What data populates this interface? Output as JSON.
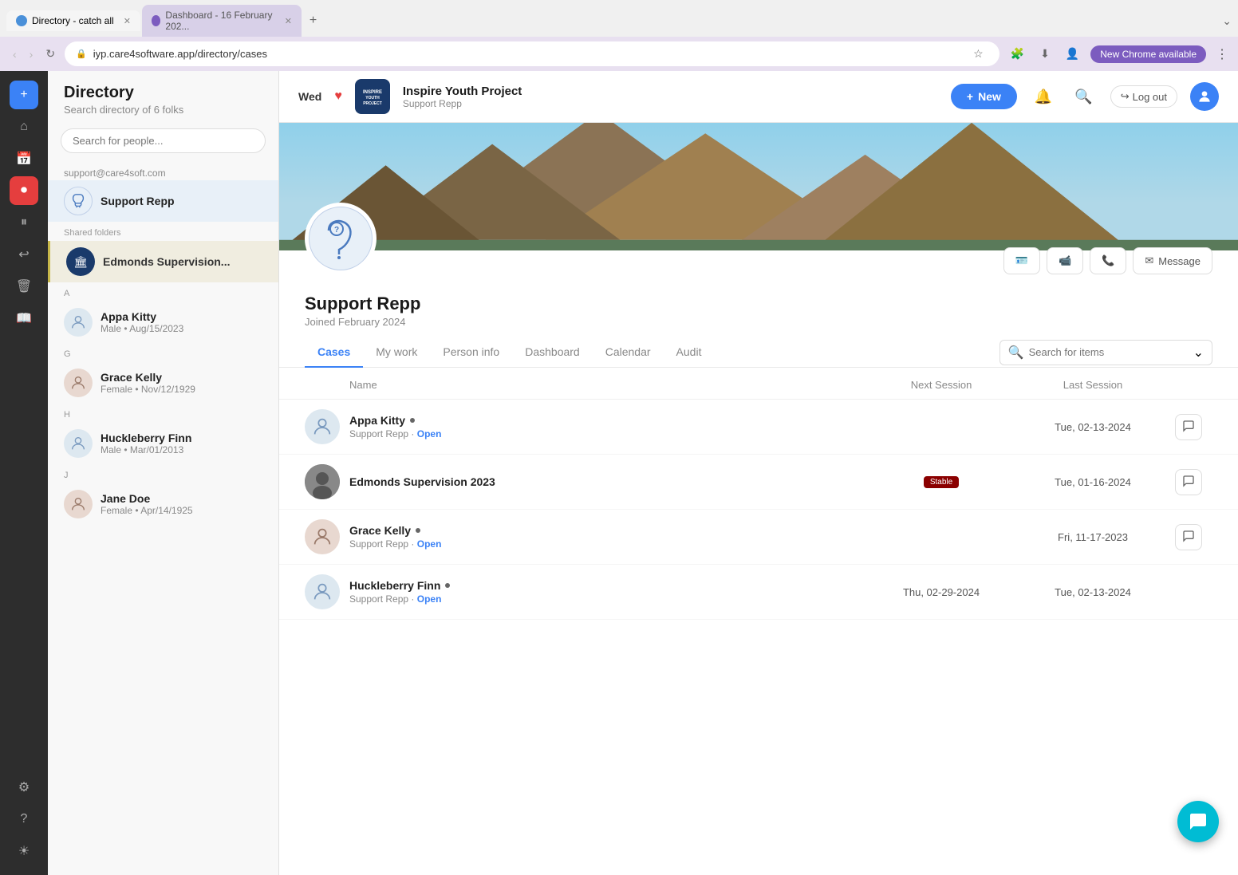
{
  "browser": {
    "tabs": [
      {
        "id": "tab1",
        "label": "Directory - catch all",
        "url": "iyp.care4software.app/directory/cases",
        "active": true,
        "favicon_color": "blue"
      },
      {
        "id": "tab2",
        "label": "Dashboard - 16 February 202...",
        "url": "",
        "active": false,
        "favicon_color": "purple"
      }
    ],
    "address": "iyp.care4software.app/directory/cases",
    "chrome_available_label": "New Chrome available",
    "new_tab_icon": "+",
    "overflow_icon": "⌄"
  },
  "header": {
    "day": "Wed",
    "heart": "♥",
    "org_name": "Inspire Youth Project",
    "org_role": "Support Repp",
    "new_button_label": "New",
    "logout_label": "Log out"
  },
  "sidebar": {
    "title": "Directory",
    "subtitle": "Search directory of 6 folks",
    "search_placeholder": "Search for people...",
    "email": "support@care4soft.com",
    "logged_in_person": {
      "name": "Support Repp",
      "type": "support"
    },
    "shared_folders_label": "Shared folders",
    "shared_folder": {
      "name": "Edmonds Supervision..."
    },
    "people": [
      {
        "section": "A",
        "name": "Appa Kitty",
        "meta": "Male • Aug/15/2023"
      },
      {
        "section": "G",
        "name": "Grace Kelly",
        "meta": "Female • Nov/12/1929"
      },
      {
        "section": "H",
        "name": "Huckleberry Finn",
        "meta": "Male • Mar/01/2013"
      },
      {
        "section": "J",
        "name": "Jane Doe",
        "meta": "Female • Apr/14/1925"
      }
    ]
  },
  "profile": {
    "name": "Support Repp",
    "joined": "Joined February 2024",
    "actions": {
      "id_card": "🪪",
      "video": "📹",
      "phone": "📞",
      "message": "Message"
    }
  },
  "tabs": {
    "items": [
      {
        "id": "cases",
        "label": "Cases",
        "active": true
      },
      {
        "id": "my-work",
        "label": "My work",
        "active": false
      },
      {
        "id": "person-info",
        "label": "Person info",
        "active": false
      },
      {
        "id": "dashboard",
        "label": "Dashboard",
        "active": false
      },
      {
        "id": "calendar",
        "label": "Calendar",
        "active": false
      },
      {
        "id": "audit",
        "label": "Audit",
        "active": false
      }
    ],
    "search_placeholder": "Search for items"
  },
  "cases_table": {
    "headers": {
      "name": "Name",
      "next_session": "Next Session",
      "last_session": "Last Session"
    },
    "rows": [
      {
        "id": "appa-kitty",
        "name": "Appa Kitty",
        "dot": true,
        "meta": "Support Repp",
        "status": "Open",
        "status_color": "#3b82f6",
        "next_session": "",
        "last_session": "Tue, 02-13-2024",
        "has_chat": true,
        "avatar_type": "person"
      },
      {
        "id": "edmonds-supervision",
        "name": "Edmonds Supervision 2023",
        "dot": false,
        "meta": "",
        "status": "",
        "status_color": "",
        "next_session": "status_badge",
        "last_session": "Tue, 01-16-2024",
        "has_chat": true,
        "avatar_type": "photo",
        "status_badge_text": "Stable"
      },
      {
        "id": "grace-kelly",
        "name": "Grace Kelly",
        "dot": true,
        "meta": "Support Repp",
        "status": "Open",
        "status_color": "#3b82f6",
        "next_session": "",
        "last_session": "Fri, 11-17-2023",
        "has_chat": true,
        "avatar_type": "person_f"
      },
      {
        "id": "huckleberry-finn",
        "name": "Huckleberry Finn",
        "dot": true,
        "meta": "Support Repp",
        "status": "Open",
        "status_color": "#3b82f6",
        "next_session": "Thu, 02-29-2024",
        "last_session": "Tue, 02-13-2024",
        "has_chat": false,
        "avatar_type": "person"
      }
    ]
  },
  "float_chat": {
    "icon": "💬"
  }
}
